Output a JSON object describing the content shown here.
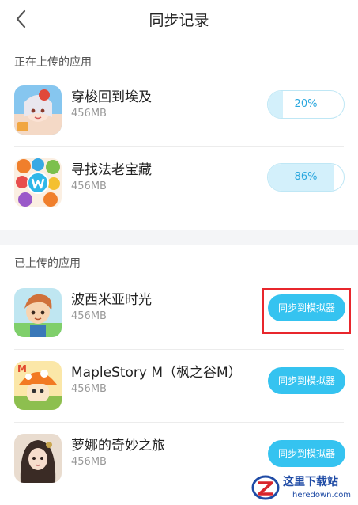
{
  "header": {
    "title": "同步记录"
  },
  "uploading": {
    "section_title": "正在上传的应用",
    "items": [
      {
        "name": "穿梭回到埃及",
        "size": "456MB",
        "progress_label": "20%",
        "progress": 0.2
      },
      {
        "name": "寻找法老宝藏",
        "size": "456MB",
        "progress_label": "86%",
        "progress": 0.86
      }
    ]
  },
  "uploaded": {
    "section_title": "已上传的应用",
    "items": [
      {
        "name": "波西米亚时光",
        "size": "456MB",
        "action_label": "同步到模拟器"
      },
      {
        "name": "MapleStory M（枫之谷M）",
        "size": "456MB",
        "action_label": "同步到模拟器"
      },
      {
        "name": "萝娜的奇妙之旅",
        "size": "456MB",
        "action_label": "同步到模拟器"
      }
    ]
  },
  "watermark": {
    "name": "这里下载站",
    "url": "heredown.com"
  },
  "colors": {
    "accent": "#35c3f0",
    "highlight": "#e8262c",
    "progress_fill": "#d3f0fb"
  }
}
